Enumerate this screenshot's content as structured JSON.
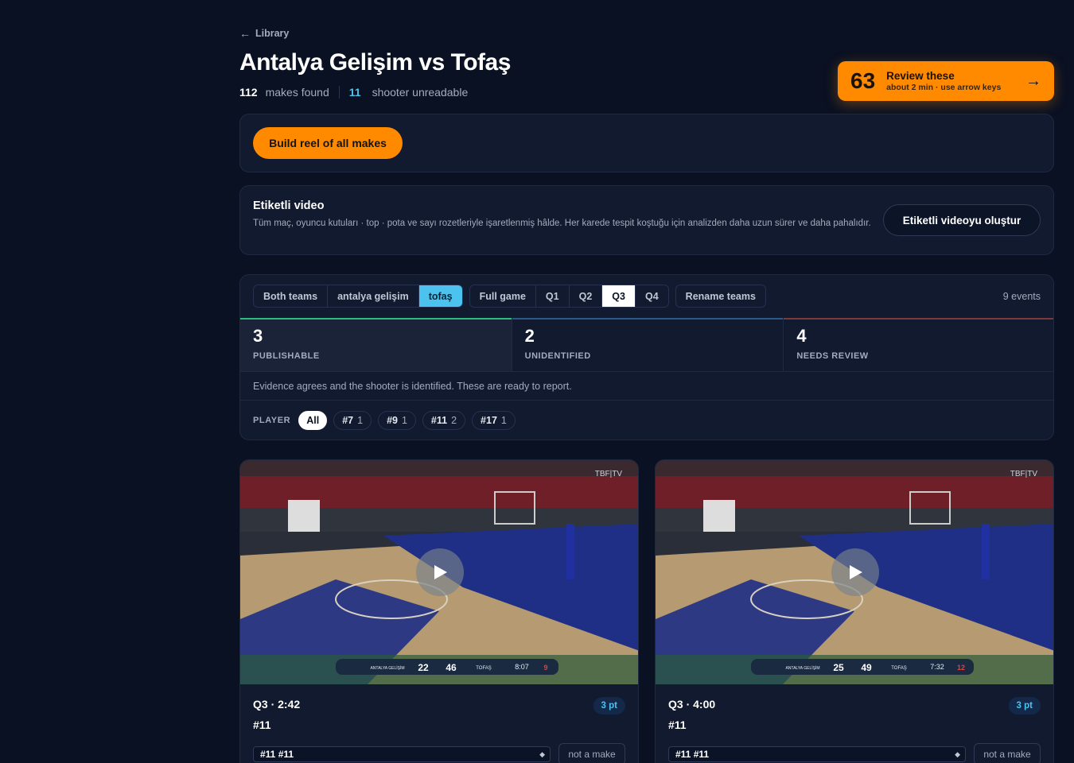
{
  "nav": {
    "back_label": "Library",
    "back_arrow": "←"
  },
  "header": {
    "title": "Antalya Gelişim vs Tofaş",
    "makes_count": "112",
    "makes_label": "makes found",
    "unreadable_count": "11",
    "unreadable_label": "shooter unreadable"
  },
  "review": {
    "count": "63",
    "title": "Review these",
    "subtitle": "about 2 min · use arrow keys",
    "arrow": "→"
  },
  "build": {
    "label": "Build reel of all makes"
  },
  "labeled_video": {
    "heading": "Etiketli video",
    "description": "Tüm maç, oyuncu kutuları · top · pota ve sayı rozetleriyle işaretlenmiş hâlde. Her karede tespit koştuğu için analizden daha uzun sürer ve daha pahalıdır.",
    "button": "Etiketli videoyu oluştur"
  },
  "filters": {
    "teams": [
      "Both teams",
      "antalya gelişim",
      "tofaş"
    ],
    "selected_team": "tofaş",
    "periods": [
      "Full game",
      "Q1",
      "Q2",
      "Q3",
      "Q4"
    ],
    "selected_period": "Q3",
    "rename": "Rename teams",
    "events": "9 events"
  },
  "buckets": [
    {
      "count": "3",
      "label": "PUBLISHABLE",
      "color": "#2bbd7e"
    },
    {
      "count": "2",
      "label": "UNIDENTIFIED",
      "color": "#2b5a8a"
    },
    {
      "count": "4",
      "label": "NEEDS REVIEW",
      "color": "#7a3a3a"
    }
  ],
  "bucket_description": "Evidence agrees and the shooter is identified. These are ready to report.",
  "players": {
    "label": "PLAYER",
    "all": "All",
    "items": [
      {
        "name": "#7",
        "count": "1"
      },
      {
        "name": "#9",
        "count": "1"
      },
      {
        "name": "#11",
        "count": "2"
      },
      {
        "name": "#17",
        "count": "1"
      }
    ]
  },
  "clips": [
    {
      "time": "Q3 · 2:42",
      "player": "#11",
      "points": "3 pt",
      "select_value": "#11 #11",
      "not_make": "not a make",
      "overlay": {
        "watermark": "TBF|TV",
        "home": "ANTALYA GELİŞİM",
        "home_score": "22",
        "away_score": "46",
        "away": "TOFAŞ",
        "clock": "8:07",
        "shot_clock": "9"
      }
    },
    {
      "time": "Q3 · 4:00",
      "player": "#11",
      "points": "3 pt",
      "select_value": "#11 #11",
      "not_make": "not a make",
      "overlay": {
        "watermark": "TBF|TV",
        "home": "ANTALYA GELİŞİM",
        "home_score": "25",
        "away_score": "49",
        "away": "TOFAŞ",
        "clock": "7:32",
        "shot_clock": "12"
      }
    }
  ],
  "colors": {
    "accent": "#ff8a00",
    "cyan": "#4cc3ee",
    "background": "#0a1122",
    "panel": "#111a2e"
  }
}
